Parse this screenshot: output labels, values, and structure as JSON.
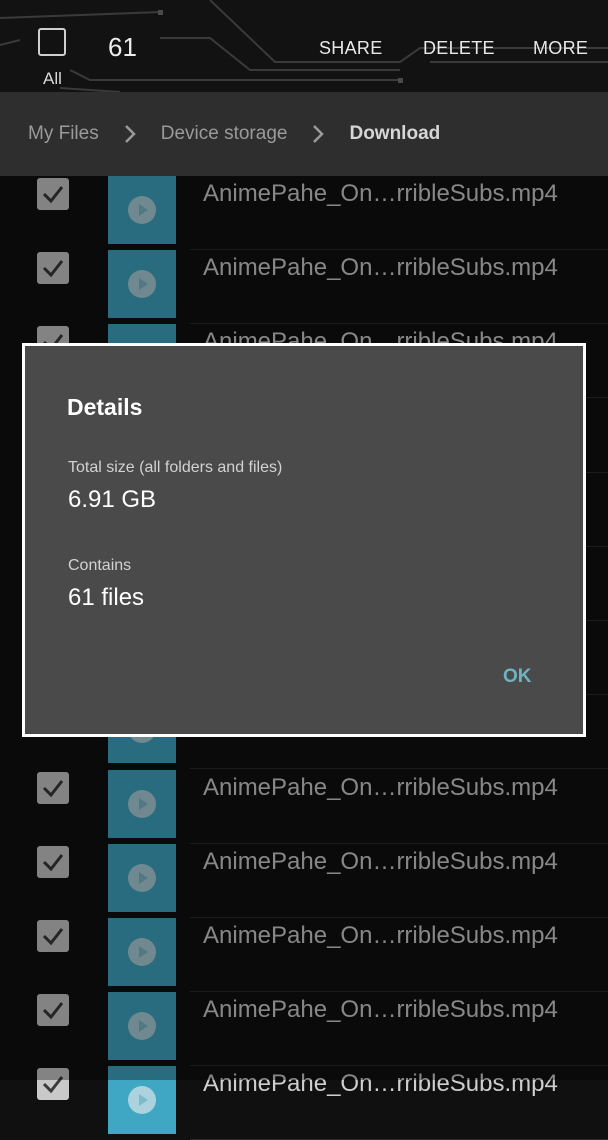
{
  "action_bar": {
    "select_all_label": "All",
    "selected_count": "61",
    "actions": [
      "SHARE",
      "DELETE",
      "MORE"
    ]
  },
  "breadcrumb": [
    "My Files",
    "Device storage",
    "Download"
  ],
  "files": [
    {
      "name": "AnimePahe_On…rribleSubs.mp4",
      "checked": true
    },
    {
      "name": "AnimePahe_On…rribleSubs.mp4",
      "checked": true
    },
    {
      "name": "AnimePahe_On…rribleSubs.mp4",
      "checked": true
    },
    {
      "name": "AnimePahe_On…rribleSubs.mp4",
      "checked": true
    },
    {
      "name": "AnimePahe_On…rribleSubs.mp4",
      "checked": true
    },
    {
      "name": "AnimePahe_On…rribleSubs.mp4",
      "checked": true
    },
    {
      "name": "AnimePahe_On…rribleSubs.mp4",
      "checked": true
    },
    {
      "name": "AnimePahe_On…rribleSubs.mp4",
      "checked": true
    },
    {
      "name": "AnimePahe_On…rribleSubs.mp4",
      "checked": true
    },
    {
      "name": "AnimePahe_On…rribleSubs.mp4",
      "checked": true
    },
    {
      "name": "AnimePahe_On…rribleSubs.mp4",
      "checked": true
    },
    {
      "name": "AnimePahe_On…rribleSubs.mp4",
      "checked": true
    },
    {
      "name": "AnimePahe_On…rribleSubs.mp4",
      "checked": true
    }
  ],
  "dialog": {
    "title": "Details",
    "total_size_label": "Total size (all folders and files)",
    "total_size_value": "6.91 GB",
    "contains_label": "Contains",
    "contains_value": "61 files",
    "ok_label": "OK"
  },
  "colors": {
    "dialog_bg": "#4a4a4a",
    "ok_accent": "#6fb3c0",
    "thumb": "#3fa7c4"
  }
}
